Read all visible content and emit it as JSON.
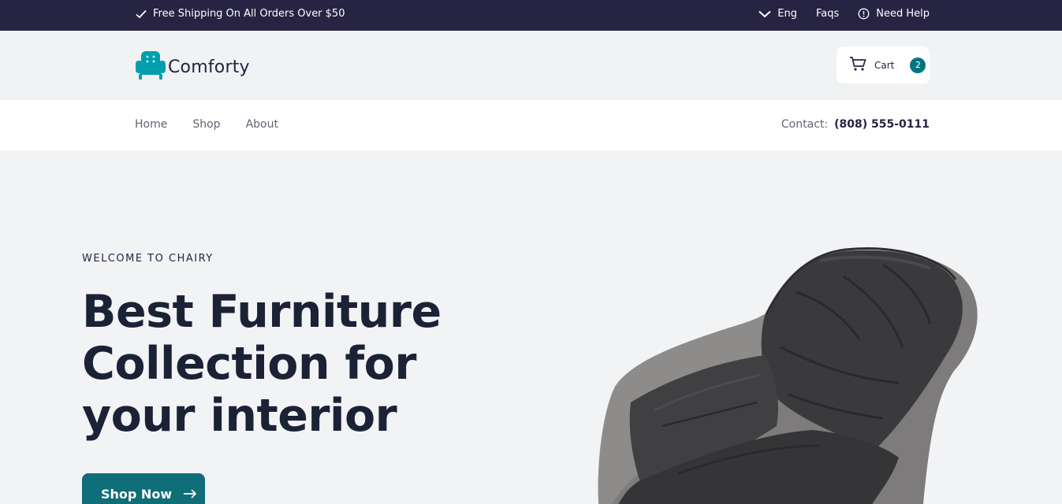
{
  "topbar": {
    "shipping_text": "Free Shipping On All Orders Over $50",
    "language": "Eng",
    "faqs": "Faqs",
    "help": "Need Help"
  },
  "header": {
    "brand": "Comforty",
    "cart_label": "Cart",
    "cart_count": "2"
  },
  "nav": {
    "items": [
      {
        "label": "Home"
      },
      {
        "label": "Shop"
      },
      {
        "label": "About"
      }
    ],
    "contact_label": "Contact:",
    "contact_phone": "(808) 555-0111"
  },
  "hero": {
    "eyebrow": "WELCOME TO CHAIRY",
    "headline": "Best Furniture Collection for your interior",
    "cta_label": "Shop Now",
    "image": "armchair-image"
  },
  "colors": {
    "topbar_bg": "#272343",
    "accent": "#007580",
    "button_bg": "#0f6e77",
    "logo": "#029fae"
  }
}
